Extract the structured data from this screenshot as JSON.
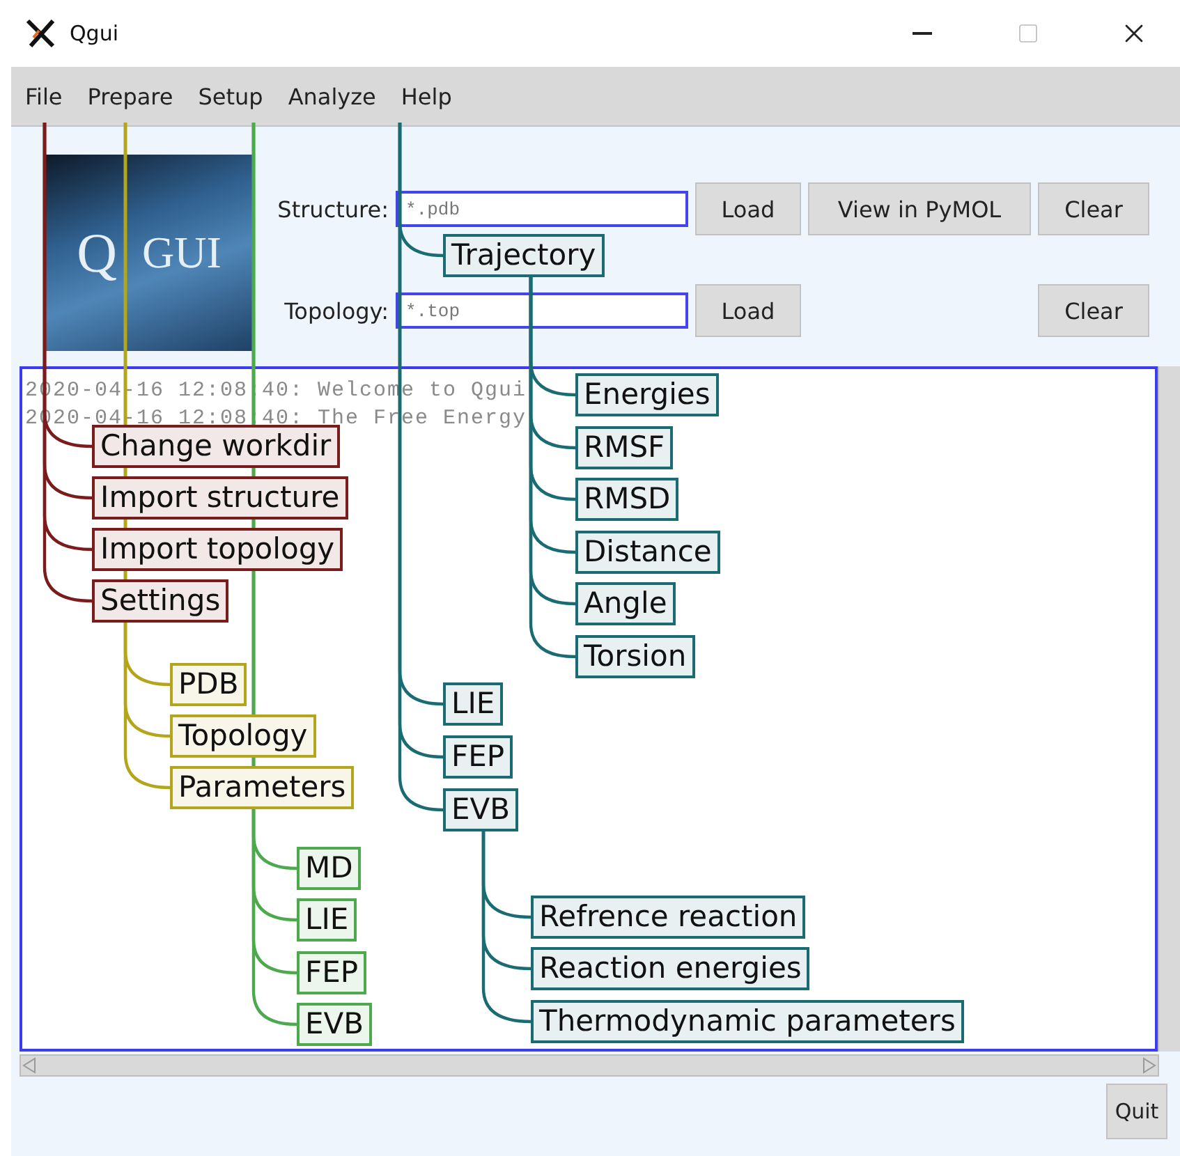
{
  "window": {
    "title": "Qgui"
  },
  "menu": [
    {
      "label": "File",
      "color": "#7a1c1c",
      "children": [
        {
          "label": "Change workdir"
        },
        {
          "label": "Import structure"
        },
        {
          "label": "Import topology"
        },
        {
          "label": "Settings"
        }
      ]
    },
    {
      "label": "Prepare",
      "color": "#b3a61c",
      "children": [
        {
          "label": "PDB"
        },
        {
          "label": "Topology"
        },
        {
          "label": "Parameters"
        }
      ]
    },
    {
      "label": "Setup",
      "color": "#4ea94e",
      "children": [
        {
          "label": "MD"
        },
        {
          "label": "LIE"
        },
        {
          "label": "FEP"
        },
        {
          "label": "EVB"
        }
      ]
    },
    {
      "label": "Analyze",
      "color": "#1b6b72",
      "children": [
        {
          "label": "Trajectory",
          "children": [
            {
              "label": "Energies"
            },
            {
              "label": "RMSF"
            },
            {
              "label": "RMSD"
            },
            {
              "label": "Distance"
            },
            {
              "label": "Angle"
            },
            {
              "label": "Torsion"
            }
          ]
        },
        {
          "label": "LIE"
        },
        {
          "label": "FEP"
        },
        {
          "label": "EVB",
          "children": [
            {
              "label": "Refrence reaction"
            },
            {
              "label": "Reaction energies"
            },
            {
              "label": "Thermodynamic parameters"
            }
          ]
        }
      ]
    },
    {
      "label": "Help"
    }
  ],
  "logo": {
    "letters": [
      "Q",
      "GUI"
    ]
  },
  "structure": {
    "label": "Structure:",
    "placeholder": "*.pdb",
    "buttons": [
      "Load",
      "View in PyMOL",
      "Clear"
    ]
  },
  "topology": {
    "label": "Topology:",
    "placeholder": "*.top",
    "buttons": [
      "Load",
      "Clear"
    ]
  },
  "log": [
    "2020-04-16 12:08:40: Welcome to Qgui",
    "2020-04-16 12:08:40: The Free Energy"
  ],
  "quit": "Quit"
}
